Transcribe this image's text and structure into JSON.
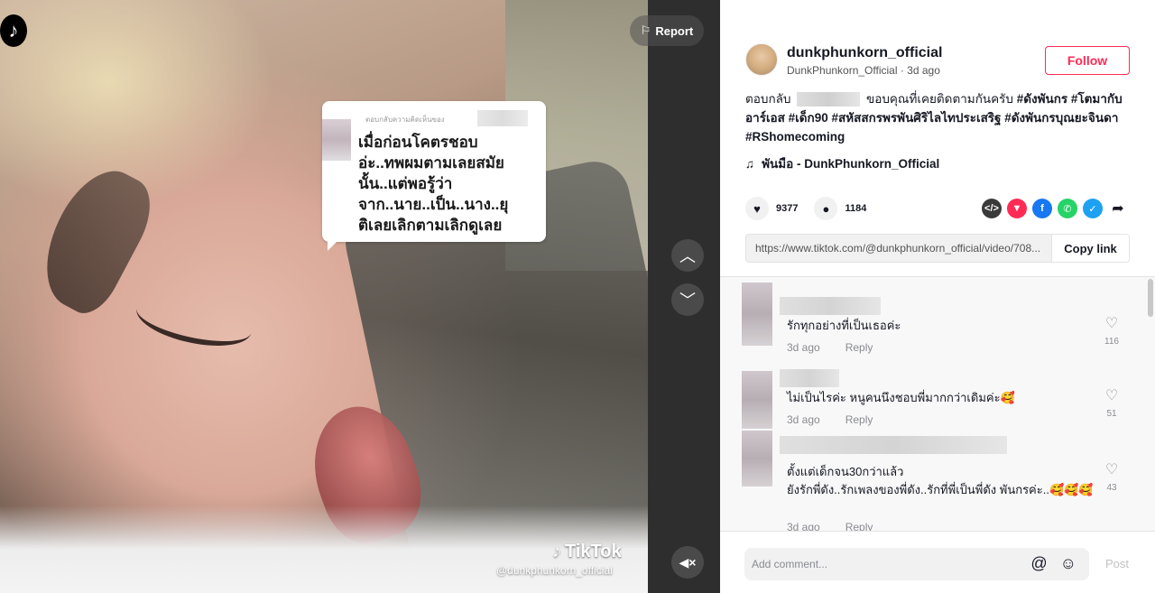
{
  "video": {
    "report_label": "Report",
    "reply_header": "ตอบกลับความคิดเห็นของ",
    "reply_text": "เมื่อก่อนโคตรชอบ\nอ่ะ..ทพผมตามเลยสมัย\nนั้น..แต่พอรู้ว่า\nจาก..นาย..เป็น..นาง..ยุ\nติเลยเลิกตามเลิกดูเลย",
    "watermark_brand": "TikTok",
    "watermark_handle": "@dunkphunkorn_official"
  },
  "author": {
    "username": "dunkphunkorn_official",
    "subtitle": "DunkPhunkorn_Official · 3d ago",
    "follow_label": "Follow"
  },
  "caption": {
    "prefix": "ตอบกลับ",
    "body": "ขอบคุณที่เคยติดตามกันครับ",
    "tags": "#ดังพันกร #โตมากับอาร์เอส #เด็ก90 #สหัสสกรพรพันศิริไลไทประเสริฐ #ดังพันกรบุณยะจินดา #RShomecoming"
  },
  "music": "พันมือ - DunkPhunkorn_Official",
  "stats": {
    "likes": "9377",
    "comments": "1184"
  },
  "share": {
    "link": "https://www.tiktok.com/@dunkphunkorn_official/video/708...",
    "copy_label": "Copy link",
    "icons": [
      "embed-icon",
      "tiktok-share-icon",
      "facebook-icon",
      "whatsapp-icon",
      "twitter-icon",
      "forward-icon"
    ]
  },
  "comments": [
    {
      "text": "รักทุกอย่างที่เป็นเธอค่ะ",
      "time": "3d ago",
      "reply": "Reply",
      "likes": "116"
    },
    {
      "text": "ไม่เป็นไรค่ะ หนูคนนึงชอบพี่มากกว่าเดิมค่ะ🥰",
      "time": "3d ago",
      "reply": "Reply",
      "likes": "51"
    },
    {
      "text": "ตั้งแต่เด็กจน30กว่าแล้ว\nยังรักพี่ดัง..รักเพลงของพี่ดัง..รักที่พี่เป็นพี่ดัง พันกรค่ะ..🥰🥰🥰",
      "time": "3d ago",
      "reply": "Reply",
      "likes": "43"
    }
  ],
  "add_comment": {
    "placeholder": "Add comment...",
    "post_label": "Post"
  },
  "colors": {
    "accent": "#fe2c55",
    "text": "#161823",
    "muted": "#8a8b91"
  }
}
